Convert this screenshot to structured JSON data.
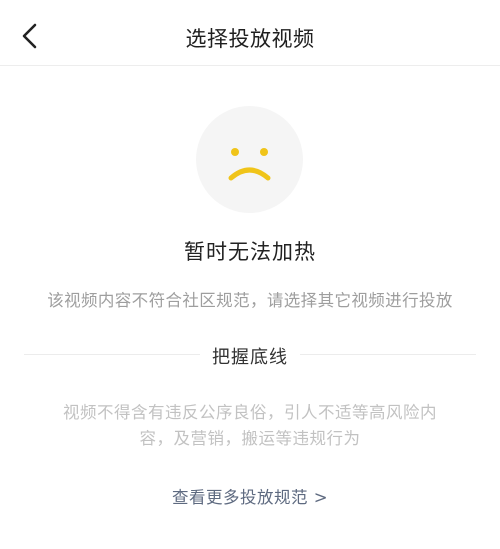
{
  "header": {
    "title": "选择投放视频",
    "back_icon": "chevron-left-icon"
  },
  "empty_state": {
    "face_icon": "sad-face-icon",
    "face_color": "#f0c419",
    "face_bg": "#f5f5f5",
    "headline": "暂时无法加热",
    "message": "该视频内容不符合社区规范，请选择其它视频进行投放"
  },
  "rules": {
    "section_title": "把握底线",
    "line1": "视频不得含有违反公序良俗，引人不适等高风险内",
    "line2": "容，及营销，搬运等违规行为",
    "more_link": "查看更多投放规范 >"
  }
}
